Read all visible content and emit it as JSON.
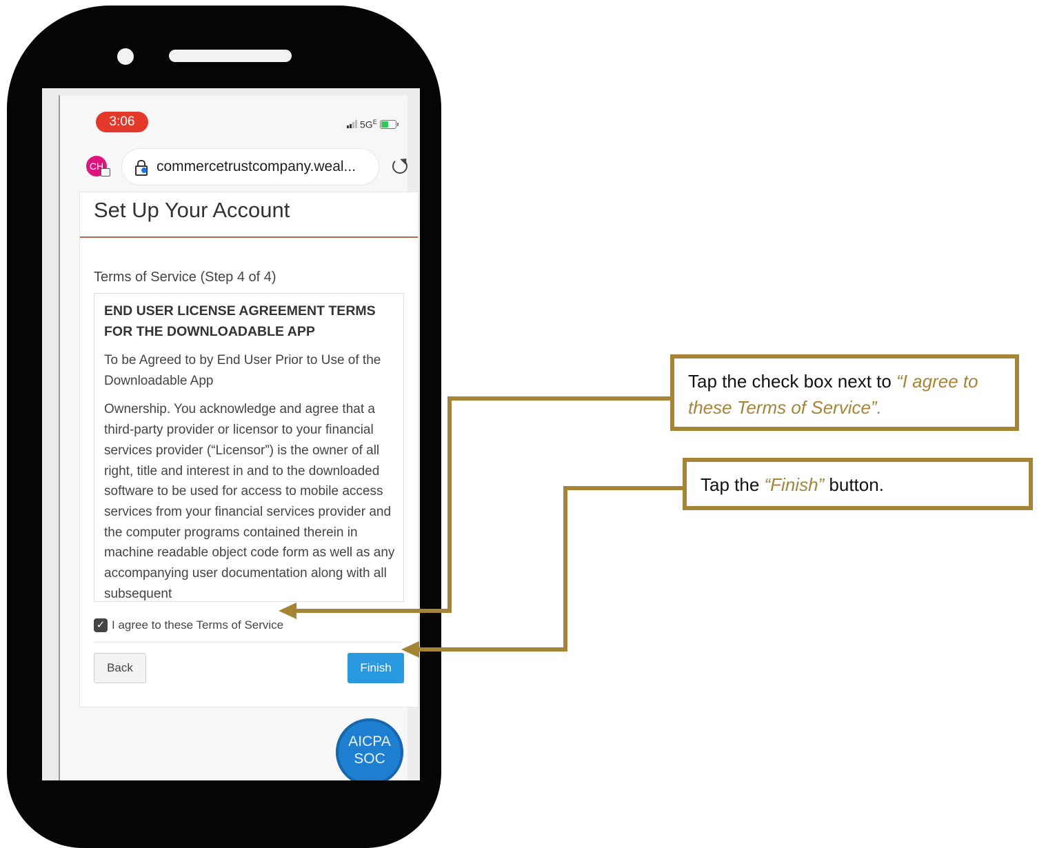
{
  "status_bar": {
    "time": "3:06",
    "network": "5G",
    "network_sup": "E"
  },
  "browser": {
    "avatar_initials": "CH",
    "url": "commercetrustcompany.weal..."
  },
  "page": {
    "title": "Set Up Your Account",
    "step_label": "Terms of Service (Step 4 of 4)",
    "tos_heading": "END USER LICENSE AGREEMENT TERMS FOR THE DOWNLOADABLE APP",
    "tos_intro": "To be Agreed to by End User Prior to Use of the Downloadable App",
    "tos_body": "Ownership. You acknowledge and agree that a third-party provider or licensor to your financial services provider (“Licensor”) is the owner of all right, title and interest in and to the downloaded software to be used for access to mobile access services from your financial services provider and the computer programs contained therein in machine readable object code form as well as any accompanying user documentation along with all subsequent",
    "agree_label": "I agree to these Terms of Service",
    "agree_checked": true,
    "back_label": "Back",
    "finish_label": "Finish"
  },
  "seal": {
    "line1": "AICPA",
    "line2": "SOC"
  },
  "callouts": {
    "checkbox": {
      "prefix": "Tap the check box next to ",
      "highlight": "“I agree to these Terms of Service”."
    },
    "finish": {
      "prefix": "Tap the ",
      "highlight": "“Finish”",
      "suffix": " button."
    }
  },
  "colors": {
    "accent_gold": "#a68436",
    "finish_blue": "#2a9ae0",
    "time_pill_red": "#e4382b",
    "title_rule": "#b5654a"
  },
  "icons": [
    "lock-icon",
    "reload-icon",
    "signal-icon",
    "battery-icon",
    "checkbox-icon"
  ]
}
